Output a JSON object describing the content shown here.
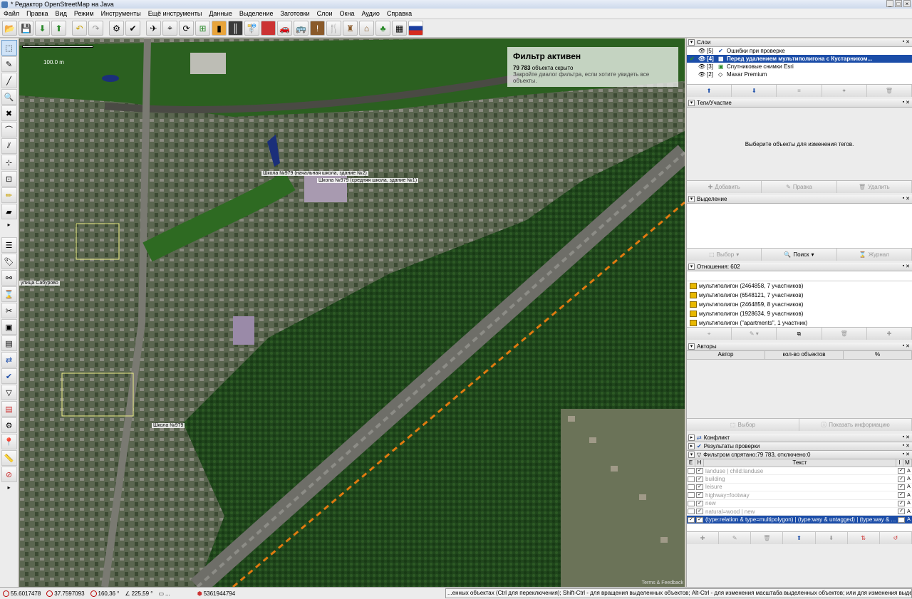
{
  "window": {
    "title": "* Редактор OpenStreetMap на Java"
  },
  "menu": [
    "Файл",
    "Правка",
    "Вид",
    "Режим",
    "Инструменты",
    "Ещё инструменты",
    "Данные",
    "Выделение",
    "Заготовки",
    "Слои",
    "Окна",
    "Аудио",
    "Справка"
  ],
  "toolbar_icons": [
    "open-icon",
    "save-icon",
    "download-icon",
    "upload-icon",
    "undo-icon",
    "redo-icon",
    "preferences-icon",
    "validate-icon",
    "wireframe-icon",
    "gps-icon",
    "refresh-icon",
    "zoom-icon",
    "traffic-light-icon",
    "road-icon",
    "bus-stop-icon",
    "area-icon",
    "car-icon",
    "bus-icon",
    "warning-icon",
    "restaurant-icon",
    "castle-icon",
    "factory-icon",
    "tree-icon",
    "checkers-icon",
    "russian-flag-icon"
  ],
  "map": {
    "scale_label": "100.0 m",
    "filter_title": "Фильтр активен",
    "filter_count": "79 783",
    "filter_status": "объекта скрыто",
    "filter_hint": "Закройте диалог фильтра, если хотите увидеть все объекты.",
    "labels": [
      "Школа №979 (начальная школа, здание №2)",
      "Школа №979 (средняя школа, здание №1)",
      "Школа №979",
      "улица Сабурово"
    ],
    "terms": "Terms & Feedback"
  },
  "layers": {
    "title": "Слои",
    "rows": [
      {
        "num": "[5]",
        "name": "Ошибки при проверке"
      },
      {
        "num": "[4]",
        "name": "Перед удалением мультиполигона с Кустарником..."
      },
      {
        "num": "[3]",
        "name": "Спутниковые снимки Esri"
      },
      {
        "num": "[2]",
        "name": "Maxar Premium"
      }
    ]
  },
  "tags": {
    "title": "Теги/Участие",
    "empty": "Выберите объекты для изменения тегов.",
    "add": "Добавить",
    "edit": "Правка",
    "delete": "Удалить"
  },
  "selection": {
    "title": "Выделение",
    "select": "Выбор",
    "search": "Поиск",
    "history": "Журнал"
  },
  "relations": {
    "title": "Отношения: 602",
    "rows": [
      "мультиполигон (2464858, 7 участников)",
      "мультиполигон (6548121, 7 участников)",
      "мультиполигон (2464859, 8 участников)",
      "мультиполигон (1928634, 9 участников)",
      "мультиполигон (\"apartments\", 1 участник)"
    ]
  },
  "authors": {
    "title": "Авторы",
    "col_author": "Автор",
    "col_count": "кол-во объектов",
    "col_pct": "%",
    "select": "Выбор",
    "info": "Показать информацию"
  },
  "conflict": {
    "title": "Конфликт"
  },
  "validation": {
    "title": "Результаты проверки"
  },
  "filter": {
    "title": "Фильтром спрятано:79 783, отключено:0",
    "col_e": "E",
    "col_h": "H",
    "col_text": "Текст",
    "col_i": "I",
    "col_m": "M",
    "rows": [
      "landuse | child:landuse",
      "building",
      "leisure",
      "highway=footway",
      "new",
      "natural=wood | new",
      "(type:relation & type=multipolygon) | (type:way & untagged) | (type:way & ..."
    ],
    "mode": "A"
  },
  "status": {
    "lat": "55.6017478",
    "lon": "37.7597093",
    "heading": "160,36 °",
    "angle": "225,59 °",
    "dist": "...",
    "id": "5361944794",
    "help": "...енных объектах (Ctrl для переключения); Shift-Ctrl - для вращения выделенных объектов; Alt-Ctrl - для изменения масштаба выделенных объектов; или для изменения выделени"
  }
}
